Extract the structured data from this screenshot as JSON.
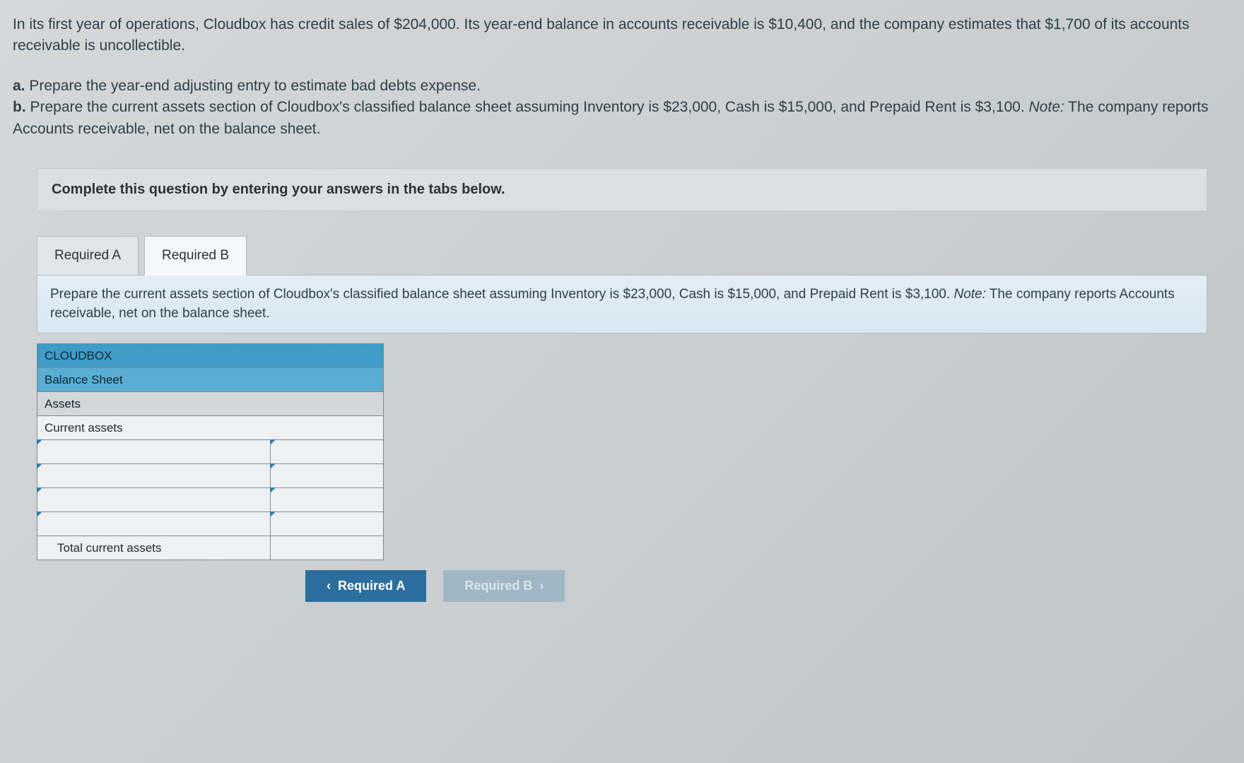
{
  "intro": "In its first year of operations, Cloudbox has credit sales of $204,000. Its year-end balance in accounts receivable is $10,400, and the company estimates that $1,700 of its accounts receivable is uncollectible.",
  "req": {
    "a_label": "a.",
    "a_text": " Prepare the year-end adjusting entry to estimate bad debts expense.",
    "b_label": "b.",
    "b_text_1": " Prepare the current assets section of Cloudbox's classified balance sheet assuming Inventory is $23,000, Cash is $15,000, and Prepaid Rent is $3,100. ",
    "note_label": "Note:",
    "b_text_2": " The company reports Accounts receivable, net on the balance sheet."
  },
  "instruct": "Complete this question by entering your answers in the tabs below.",
  "tabs": {
    "a": "Required A",
    "b": "Required B"
  },
  "panel": {
    "text_1": "Prepare the current assets section of Cloudbox's classified balance sheet assuming Inventory is $23,000, Cash is $15,000, and Prepaid Rent is $3,100. ",
    "note_label": "Note:",
    "text_2": " The company reports Accounts receivable, net on the balance sheet."
  },
  "sheet": {
    "company": "CLOUDBOX",
    "title": "Balance Sheet",
    "section": "Assets",
    "subhead": "Current assets",
    "total_label": "Total current assets"
  },
  "nav": {
    "prev": "Required A",
    "next": "Required B"
  }
}
